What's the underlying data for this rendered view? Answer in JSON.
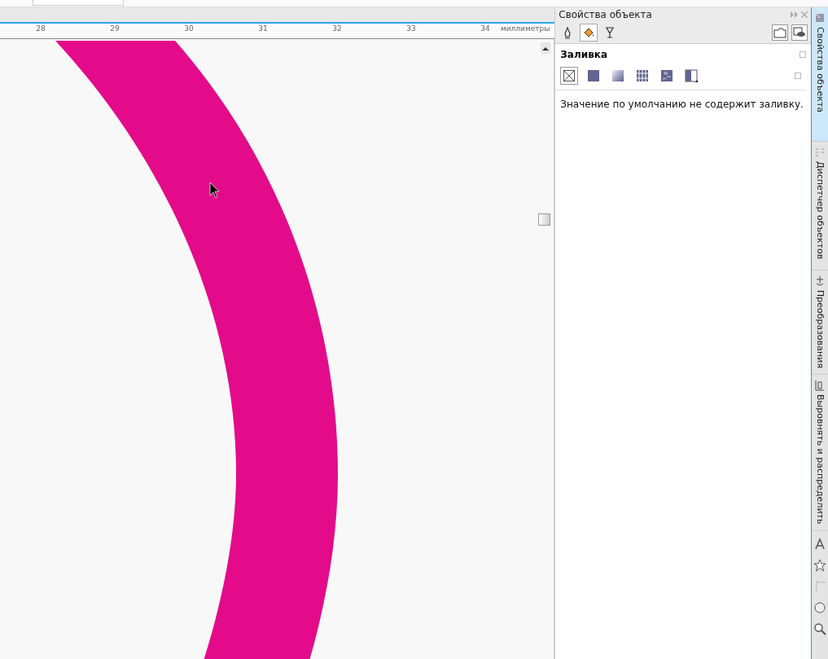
{
  "ruler": {
    "ticks": [
      "28",
      "29",
      "30",
      "31",
      "32",
      "33",
      "34"
    ],
    "unit": "миллиметры"
  },
  "panel": {
    "title": "Свойства объекта",
    "tools": [
      {
        "kind": "outline",
        "selected": false
      },
      {
        "kind": "fill",
        "selected": true
      },
      {
        "kind": "transparency",
        "selected": false
      }
    ],
    "section_title": "Заливка",
    "fill_types": [
      {
        "kind": "none",
        "selected": true
      },
      {
        "kind": "uniform",
        "selected": false
      },
      {
        "kind": "gradient",
        "selected": false
      },
      {
        "kind": "pattern",
        "selected": false
      },
      {
        "kind": "texture",
        "selected": false
      },
      {
        "kind": "postscript",
        "selected": false
      }
    ],
    "message": "Значение по умолчанию не содержит заливку."
  },
  "docker_tabs": [
    {
      "label": "Свойства объекта",
      "selected": true
    },
    {
      "label": "Диспетчер объектов",
      "selected": false
    },
    {
      "label": "Преобразования",
      "selected": false
    },
    {
      "label": "Выровнять и распределить",
      "selected": false
    }
  ]
}
